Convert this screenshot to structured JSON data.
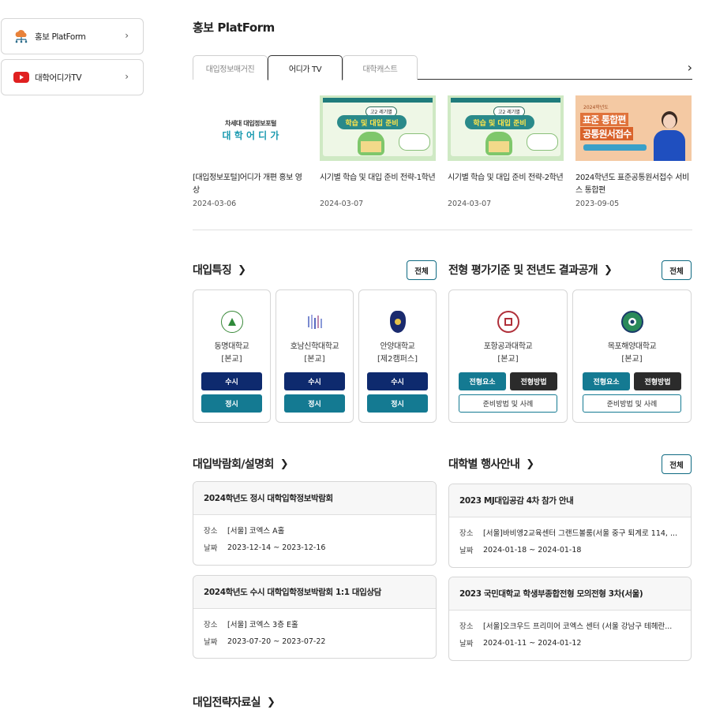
{
  "sidebar": {
    "items": [
      {
        "label": "홍보 PlatForm",
        "icon": "cloud-network-icon"
      },
      {
        "label": "대학어디가TV",
        "icon": "youtube-icon"
      }
    ]
  },
  "header": {
    "title": "홍보 PlatForm"
  },
  "tabs": [
    {
      "label": "대입정보매거진",
      "active": false
    },
    {
      "label": "어디가 TV",
      "active": true
    },
    {
      "label": "대학캐스트",
      "active": false
    }
  ],
  "videos": [
    {
      "thumb_line1": "차세대 대입정보포털",
      "thumb_line2": "대 학 어 디 가",
      "title": "[대입정보포털]어디가 개편 홍보 영상",
      "date": "2024-03-06"
    },
    {
      "thumb_tag": "고2 레기별",
      "thumb_main": "학습 및 대입 준비",
      "title": "시기별 학습 및 대입 준비 전략-1학년",
      "date": "2024-03-07"
    },
    {
      "thumb_tag": "고2 레기별",
      "thumb_main": "학습 및 대입 준비",
      "title": "시기별 학습 및 대입 준비 전략-2학년",
      "date": "2024-03-07"
    },
    {
      "thumb_line1": "2024학년도",
      "thumb_line2": "표준 통합편",
      "thumb_line3": "공통원서접수",
      "title": "2024학년도 표준공통원서접수 서비스 통합편",
      "date": "2023-09-05"
    }
  ],
  "admission": {
    "title": "대입특징",
    "all_label": "전체",
    "unis": [
      {
        "name": "동명대학교",
        "campus": "[본교]",
        "btn1": "수시",
        "btn2": "정시"
      },
      {
        "name": "호남신학대학교",
        "campus": "[본교]",
        "btn1": "수시",
        "btn2": "정시"
      },
      {
        "name": "안양대학교",
        "campus": "[제2캠퍼스]",
        "btn1": "수시",
        "btn2": "정시"
      }
    ]
  },
  "results": {
    "title": "전형 평가기준 및 전년도 결과공개",
    "all_label": "전체",
    "unis": [
      {
        "name": "포항공과대학교",
        "campus": "[본교]",
        "btn1": "전형요소",
        "btn2": "전형방법",
        "btn3": "준비방법 및 사례"
      },
      {
        "name": "목포해양대학교",
        "campus": "[본교]",
        "btn1": "전형요소",
        "btn2": "전형방법",
        "btn3": "준비방법 및 사례"
      }
    ]
  },
  "fairs": {
    "title": "대입박람회/설명회",
    "place_key": "장소",
    "date_key": "날짜",
    "items": [
      {
        "title": "2024학년도 정시 대학입학정보박람회",
        "place": "[서울] 코엑스 A홀",
        "date": "2023-12-14 ~ 2023-12-16"
      },
      {
        "title": "2024학년도 수시 대학입학정보박람회 1:1 대입상담",
        "place": "[서울] 코엑스 3층 E홀",
        "date": "2023-07-20 ~ 2023-07-22"
      }
    ]
  },
  "events": {
    "title": "대학별 행사안내",
    "all_label": "전체",
    "place_key": "장소",
    "date_key": "날짜",
    "items": [
      {
        "title": "2023 MJ대입공감 4차 참가 안내",
        "place": "[서울]바비엥2교육센터 그랜드볼룸(서울 중구 퇴계로 114, ...",
        "date": "2024-01-18 ~ 2024-01-18"
      },
      {
        "title": "2023 국민대학교 학생부종합전형 모의전형 3차(서울)",
        "place": "[서울]오크우드 프리미어 코엑스 센터 (서울 강남구 테헤란...",
        "date": "2024-01-11 ~ 2024-01-12"
      }
    ]
  },
  "strategy": {
    "title": "대입전략자료실"
  }
}
